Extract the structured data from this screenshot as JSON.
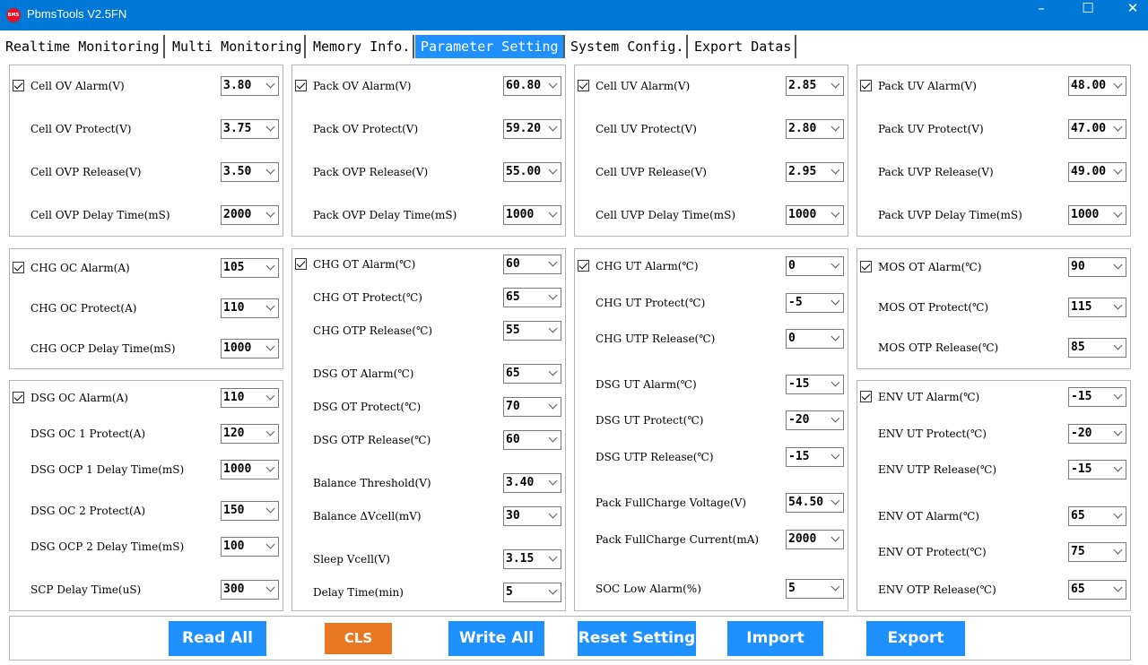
{
  "window": {
    "title": "PbmsTools V2.5FN",
    "logo_text": "BMS"
  },
  "tabs": [
    {
      "label": "Realtime Monitoring"
    },
    {
      "label": "Multi Monitoring"
    },
    {
      "label": "Memory Info."
    },
    {
      "label": "Parameter Setting"
    },
    {
      "label": "System Config."
    },
    {
      "label": "Export Datas"
    }
  ],
  "panels": {
    "cell_ov": {
      "alarm": {
        "label": "Cell OV Alarm(V)",
        "value": "3.80",
        "checked": true
      },
      "protect": {
        "label": "Cell OV Protect(V)",
        "value": "3.75"
      },
      "release": {
        "label": "Cell OVP Release(V)",
        "value": "3.50"
      },
      "delay": {
        "label": "Cell OVP Delay Time(mS)",
        "value": "2000"
      }
    },
    "pack_ov": {
      "alarm": {
        "label": "Pack OV Alarm(V)",
        "value": "60.80",
        "checked": true
      },
      "protect": {
        "label": "Pack OV Protect(V)",
        "value": "59.20"
      },
      "release": {
        "label": "Pack OVP Release(V)",
        "value": "55.00"
      },
      "delay": {
        "label": "Pack OVP Delay Time(mS)",
        "value": "1000"
      }
    },
    "cell_uv": {
      "alarm": {
        "label": "Cell UV Alarm(V)",
        "value": "2.85",
        "checked": true
      },
      "protect": {
        "label": "Cell UV Protect(V)",
        "value": "2.80"
      },
      "release": {
        "label": "Cell UVP Release(V)",
        "value": "2.95"
      },
      "delay": {
        "label": "Cell UVP Delay Time(mS)",
        "value": "1000"
      }
    },
    "pack_uv": {
      "alarm": {
        "label": "Pack UV Alarm(V)",
        "value": "48.00",
        "checked": true
      },
      "protect": {
        "label": "Pack UV Protect(V)",
        "value": "47.00"
      },
      "release": {
        "label": "Pack UVP Release(V)",
        "value": "49.00"
      },
      "delay": {
        "label": "Pack UVP Delay Time(mS)",
        "value": "1000"
      }
    },
    "chg_oc": {
      "alarm": {
        "label": "CHG OC Alarm(A)",
        "value": "105",
        "checked": true
      },
      "protect": {
        "label": "CHG OC Protect(A)",
        "value": "110"
      },
      "delay": {
        "label": "CHG OCP Delay Time(mS)",
        "value": "1000"
      }
    },
    "dsg_oc": {
      "alarm": {
        "label": "DSG OC Alarm(A)",
        "value": "110",
        "checked": true
      },
      "protect1": {
        "label": "DSG OC 1 Protect(A)",
        "value": "120"
      },
      "delay1": {
        "label": "DSG OCP 1 Delay Time(mS)",
        "value": "1000"
      },
      "protect2": {
        "label": "DSG OC 2 Protect(A)",
        "value": "150"
      },
      "delay2": {
        "label": "DSG OCP 2 Delay Time(mS)",
        "value": "100"
      },
      "scp": {
        "label": "SCP Delay Time(uS)",
        "value": "300"
      }
    },
    "temp_chg_dsg_ot": {
      "chg_alarm": {
        "label": "CHG OT Alarm(℃)",
        "value": "60",
        "checked": true
      },
      "chg_protect": {
        "label": "CHG OT Protect(℃)",
        "value": "65"
      },
      "chg_release": {
        "label": "CHG OTP Release(℃)",
        "value": "55"
      },
      "dsg_alarm": {
        "label": "DSG OT Alarm(℃)",
        "value": "65"
      },
      "dsg_protect": {
        "label": "DSG OT Protect(℃)",
        "value": "70"
      },
      "dsg_release": {
        "label": "DSG OTP Release(℃)",
        "value": "60"
      },
      "balance_threshold": {
        "label": "Balance Threshold(V)",
        "value": "3.40"
      },
      "balance_dvcell": {
        "label": "Balance ΔVcell(mV)",
        "value": "30"
      },
      "sleep_vcell": {
        "label": "Sleep Vcell(V)",
        "value": "3.15"
      },
      "delay_time": {
        "label": "Delay Time(min)",
        "value": "5"
      }
    },
    "temp_ut": {
      "chg_alarm": {
        "label": "CHG UT Alarm(℃)",
        "value": "0",
        "checked": true
      },
      "chg_protect": {
        "label": "CHG UT Protect(℃)",
        "value": "-5"
      },
      "chg_release": {
        "label": "CHG UTP Release(℃)",
        "value": "0"
      },
      "dsg_alarm": {
        "label": "DSG UT Alarm(℃)",
        "value": "-15"
      },
      "dsg_protect": {
        "label": "DSG UT Protect(℃)",
        "value": "-20"
      },
      "dsg_release": {
        "label": "DSG UTP Release(℃)",
        "value": "-15"
      },
      "full_voltage": {
        "label": "Pack FullCharge Voltage(V)",
        "value": "54.50"
      },
      "full_current": {
        "label": "Pack FullCharge Current(mA)",
        "value": "2000"
      },
      "soc_low": {
        "label": "SOC Low Alarm(%)",
        "value": "5"
      }
    },
    "mos_ot": {
      "alarm": {
        "label": "MOS OT Alarm(℃)",
        "value": "90",
        "checked": true
      },
      "protect": {
        "label": "MOS OT Protect(℃)",
        "value": "115"
      },
      "release": {
        "label": "MOS OTP Release(℃)",
        "value": "85"
      }
    },
    "env": {
      "ut_alarm": {
        "label": "ENV UT Alarm(℃)",
        "value": "-15",
        "checked": true
      },
      "ut_protect": {
        "label": "ENV UT Protect(℃)",
        "value": "-20"
      },
      "ut_release": {
        "label": "ENV UTP Release(℃)",
        "value": "-15"
      },
      "ot_alarm": {
        "label": "ENV OT Alarm(℃)",
        "value": "65"
      },
      "ot_protect": {
        "label": "ENV OT Protect(℃)",
        "value": "75"
      },
      "ot_release": {
        "label": "ENV OTP Release(℃)",
        "value": "65"
      }
    }
  },
  "buttons": {
    "read_all": "Read All",
    "cls": "CLS",
    "write_all": "Write All",
    "reset_setting": "Reset Setting",
    "import": "Import",
    "export": "Export"
  },
  "colors": {
    "titlebar": "#0078d7",
    "active_tab": "#1e90ff",
    "primary_button": "#1e90ff",
    "cls_button": "#e87722"
  }
}
